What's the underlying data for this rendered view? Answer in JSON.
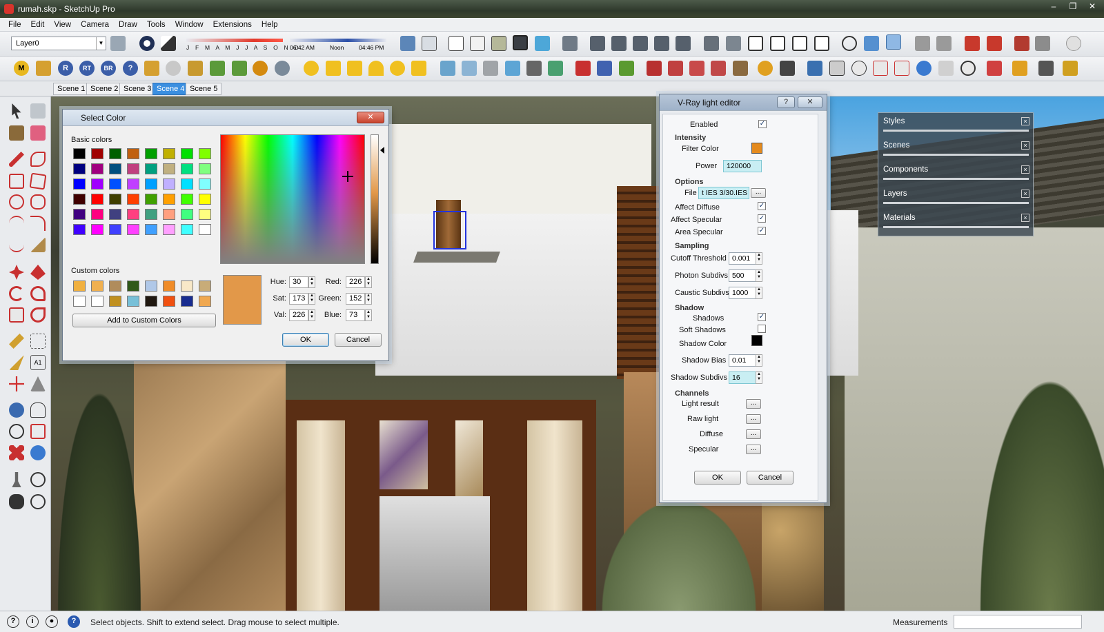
{
  "window": {
    "title": "rumah.skp - SketchUp Pro",
    "controls": [
      "–",
      "❐",
      "✕"
    ]
  },
  "menu": [
    "File",
    "Edit",
    "View",
    "Camera",
    "Draw",
    "Tools",
    "Window",
    "Extensions",
    "Help"
  ],
  "toolbar": {
    "layer": "Layer0",
    "months": "J F M A M J J A S O N D",
    "time_start": "06:42 AM",
    "time_noon": "Noon",
    "time_end": "04:46 PM",
    "plugin_labels": [
      "M",
      "R",
      "RT",
      "BR",
      "?"
    ]
  },
  "scenes": {
    "tabs": [
      "Scene 1",
      "Scene 2",
      "Scene 3",
      "Scene 4",
      "Scene 5"
    ],
    "active": "Scene 4"
  },
  "select_color": {
    "title": "Select Color",
    "basic_label": "Basic colors",
    "custom_label": "Custom colors",
    "basic_colors": [
      [
        "#000000",
        "#a00000",
        "#006000",
        "#c06010",
        "#00a000",
        "#c0b000",
        "#00e000",
        "#80ff00"
      ],
      [
        "#000080",
        "#a00080",
        "#005080",
        "#c04080",
        "#00a080",
        "#c0b080",
        "#00e080",
        "#80ff80"
      ],
      [
        "#0000ff",
        "#a000ff",
        "#0050ff",
        "#c040ff",
        "#00a0ff",
        "#c0b0ff",
        "#00e0ff",
        "#80ffff"
      ],
      [
        "#400000",
        "#ff0000",
        "#404000",
        "#ff4000",
        "#40a000",
        "#ffa000",
        "#40ff00",
        "#ffff00"
      ],
      [
        "#400080",
        "#ff0080",
        "#404080",
        "#ff4080",
        "#40a080",
        "#ffa080",
        "#40ff80",
        "#ffff80"
      ],
      [
        "#4000ff",
        "#ff00ff",
        "#4040ff",
        "#ff40ff",
        "#40a0ff",
        "#ffa0ff",
        "#40ffff",
        "#ffffff"
      ]
    ],
    "custom_colors": [
      [
        "#f0b040",
        "#f0b050",
        "#b08c5c",
        "#305818",
        "#b0c8e8",
        "#f08c28",
        "#f8e8c8",
        "#c8ac78"
      ],
      [
        "#ffffff",
        "#ffffff",
        "#c09020",
        "#78c0d8",
        "#201810",
        "#f05010",
        "#182c90",
        "#f0a850"
      ]
    ],
    "preview_color": "#e29849",
    "hue_label": "Hue:",
    "hue": "30",
    "sat_label": "Sat:",
    "sat": "173",
    "val_label": "Val:",
    "val": "226",
    "red_label": "Red:",
    "red": "226",
    "green_label": "Green:",
    "green": "152",
    "blue_label": "Blue:",
    "blue": "73",
    "add_custom": "Add to Custom Colors",
    "ok": "OK",
    "cancel": "Cancel"
  },
  "vray": {
    "title": "V-Ray light editor",
    "help": "?",
    "enabled_label": "Enabled",
    "enabled": true,
    "intensity_header": "Intensity",
    "filter_color_label": "Filter Color",
    "filter_color": "#e48a1e",
    "power_label": "Power",
    "power": "120000",
    "options_header": "Options",
    "file_label": "File",
    "file": "t IES 3/30.IES",
    "affect_diffuse_label": "Affect Diffuse",
    "affect_specular_label": "Affect Specular",
    "area_specular_label": "Area Specular",
    "sampling_header": "Sampling",
    "cutoff_label": "Cutoff Threshold",
    "cutoff": "0.001",
    "photon_label": "Photon Subdivs",
    "photon": "500",
    "caustic_label": "Caustic Subdivs",
    "caustic": "1000",
    "shadow_header": "Shadow",
    "shadows_label": "Shadows",
    "soft_shadows_label": "Soft Shadows",
    "shadow_color_label": "Shadow Color",
    "shadow_color": "#000000",
    "shadow_bias_label": "Shadow Bias",
    "shadow_bias": "0.01",
    "shadow_subdivs_label": "Shadow Subdivs",
    "shadow_subdivs": "16",
    "channels_header": "Channels",
    "light_result_label": "Light result",
    "raw_light_label": "Raw light",
    "diffuse_label": "Diffuse",
    "specular_label": "Specular",
    "dots": "...",
    "ok": "OK",
    "cancel": "Cancel"
  },
  "tray": [
    "Styles",
    "Scenes",
    "Components",
    "Layers",
    "Materials"
  ],
  "status": {
    "hint": "Select objects. Shift to extend select. Drag mouse to select multiple.",
    "measurements_label": "Measurements"
  }
}
